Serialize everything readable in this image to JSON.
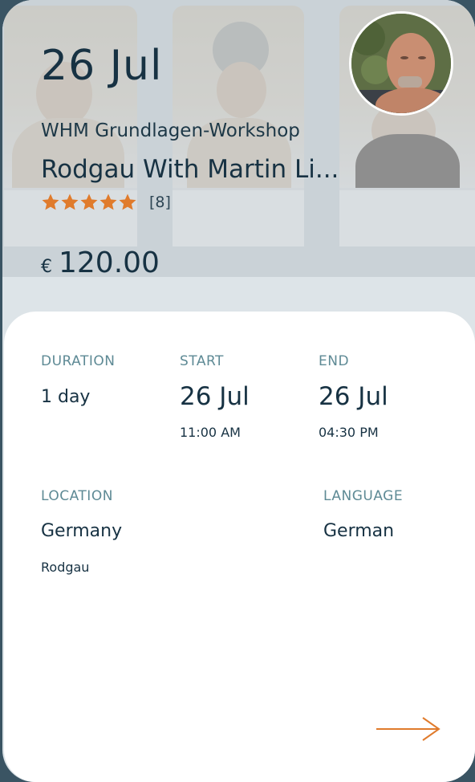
{
  "event": {
    "date": "26 Jul",
    "subtitle": "WHM Grundlagen-Workshop",
    "title": "Rodgau With Martin Li...",
    "rating": 5,
    "rating_max": 5,
    "rating_count": "[8]",
    "currency": "€",
    "price": "120.00"
  },
  "details": {
    "duration_label": "DURATION",
    "duration_value": "1 day",
    "start_label": "START",
    "start_date": "26 Jul",
    "start_time": "11:00 AM",
    "end_label": "END",
    "end_date": "26 Jul",
    "end_time": "04:30 PM",
    "location_label": "LOCATION",
    "location_country": "Germany",
    "location_city": "Rodgau",
    "language_label": "LANGUAGE",
    "language_value": "German"
  },
  "icons": {
    "star": "star-icon",
    "arrow": "arrow-right-icon"
  },
  "colors": {
    "accent_orange": "#e07b2c",
    "label_teal": "#5e8a95",
    "text_dark": "#173243",
    "frame": "#3a5463"
  }
}
